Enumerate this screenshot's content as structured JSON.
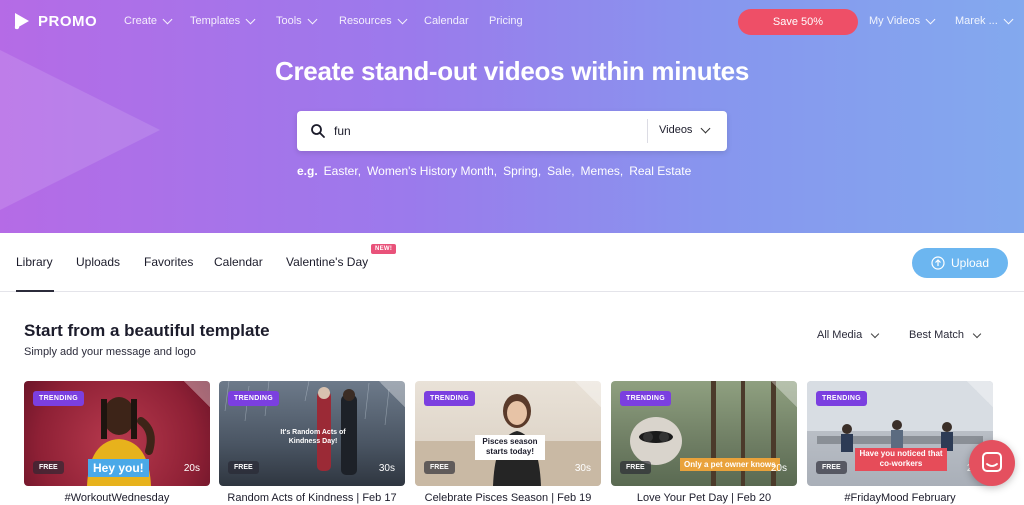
{
  "brand": {
    "name": "PROMO"
  },
  "nav": {
    "items": [
      {
        "label": "Create",
        "dropdown": true
      },
      {
        "label": "Templates",
        "dropdown": true
      },
      {
        "label": "Tools",
        "dropdown": true
      },
      {
        "label": "Resources",
        "dropdown": true
      },
      {
        "label": "Calendar",
        "dropdown": false
      },
      {
        "label": "Pricing",
        "dropdown": false
      }
    ],
    "save_label": "Save 50%",
    "my_videos_label": "My Videos",
    "user_label": "Marek ..."
  },
  "hero": {
    "title": "Create stand-out videos within minutes",
    "search": {
      "value": "fun",
      "type": "Videos"
    },
    "examples_prefix": "e.g.",
    "examples": [
      "Easter,",
      "Women's History Month,",
      "Spring,",
      "Sale,",
      "Memes,",
      "Real Estate"
    ]
  },
  "tabs": {
    "items": [
      "Library",
      "Uploads",
      "Favorites",
      "Calendar",
      "Valentine's Day"
    ],
    "active": "Library",
    "new_badge": "NEW!",
    "upload_label": "Upload"
  },
  "section": {
    "title": "Start from a beautiful template",
    "subtitle": "Simply add your message and logo",
    "filters": {
      "media": "All Media",
      "sort": "Best Match"
    }
  },
  "cards": [
    {
      "title": "#WorkoutWednesday",
      "badge": "TRENDING",
      "tier": "FREE",
      "duration": "20s",
      "overlay": "Hey you!"
    },
    {
      "title": "Random Acts of Kindness | Feb 17",
      "badge": "TRENDING",
      "tier": "FREE",
      "duration": "30s",
      "overlay": "It's Random Acts of Kindness Day!"
    },
    {
      "title": "Celebrate Pisces Season | Feb 19",
      "badge": "TRENDING",
      "tier": "FREE",
      "duration": "30s",
      "overlay": "Pisces season starts today!"
    },
    {
      "title": "Love Your Pet Day | Feb 20",
      "badge": "TRENDING",
      "tier": "FREE",
      "duration": "20s",
      "overlay": "Only a pet owner knows"
    },
    {
      "title": "#FridayMood February",
      "badge": "TRENDING",
      "tier": "FREE",
      "duration": "20s",
      "overlay": "Have you noticed that co-workers"
    }
  ],
  "colors": {
    "save_button": "#ee4f67",
    "upload_button": "#6cb6f0",
    "trending_badge": "#7b3fe0",
    "chat_button": "#e4505f"
  }
}
